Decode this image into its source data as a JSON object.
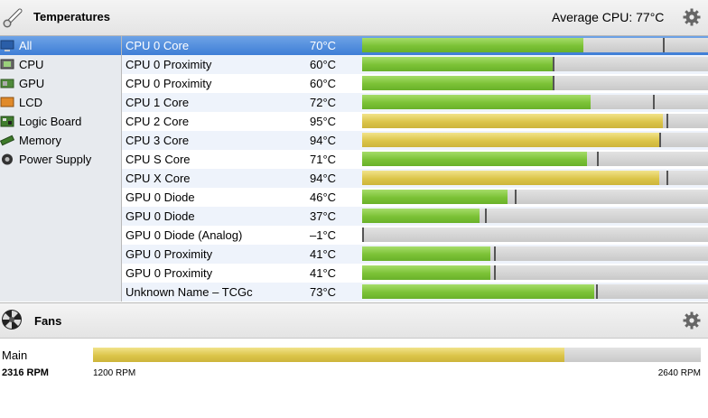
{
  "temperatures": {
    "title": "Temperatures",
    "average_label": "Average CPU:  77°C"
  },
  "sidebar": {
    "items": [
      {
        "label": "All",
        "icon": "all-icon",
        "selected": true
      },
      {
        "label": "CPU",
        "icon": "cpu-icon"
      },
      {
        "label": "GPU",
        "icon": "gpu-icon"
      },
      {
        "label": "LCD",
        "icon": "lcd-icon"
      },
      {
        "label": "Logic Board",
        "icon": "logic-board-icon"
      },
      {
        "label": "Memory",
        "icon": "memory-icon"
      },
      {
        "label": "Power Supply",
        "icon": "power-supply-icon"
      }
    ]
  },
  "sensors": [
    {
      "name": "CPU 0 Core",
      "value": "70°C",
      "level": 0.64,
      "max_marker": 0.87,
      "color": "green",
      "selected": true
    },
    {
      "name": "CPU 0 Proximity",
      "value": "60°C",
      "level": 0.55,
      "max_marker": 0.55,
      "color": "green"
    },
    {
      "name": "CPU 0 Proximity",
      "value": "60°C",
      "level": 0.55,
      "max_marker": 0.55,
      "color": "green"
    },
    {
      "name": "CPU 1 Core",
      "value": "72°C",
      "level": 0.66,
      "max_marker": 0.84,
      "color": "green"
    },
    {
      "name": "CPU 2 Core",
      "value": "95°C",
      "level": 0.87,
      "max_marker": 0.88,
      "color": "yellow"
    },
    {
      "name": "CPU 3 Core",
      "value": "94°C",
      "level": 0.86,
      "max_marker": 0.86,
      "color": "yellow"
    },
    {
      "name": "CPU S Core",
      "value": "71°C",
      "level": 0.65,
      "max_marker": 0.68,
      "color": "green"
    },
    {
      "name": "CPU X Core",
      "value": "94°C",
      "level": 0.86,
      "max_marker": 0.88,
      "color": "yellow"
    },
    {
      "name": "GPU 0 Diode",
      "value": "46°C",
      "level": 0.42,
      "max_marker": 0.44,
      "color": "green"
    },
    {
      "name": "GPU 0 Diode",
      "value": "37°C",
      "level": 0.34,
      "max_marker": 0.355,
      "color": "green"
    },
    {
      "name": "GPU 0 Diode (Analog)",
      "value": "–1°C",
      "level": 0.0,
      "max_marker": 0.0,
      "color": "green"
    },
    {
      "name": "GPU 0 Proximity",
      "value": "41°C",
      "level": 0.37,
      "max_marker": 0.38,
      "color": "green"
    },
    {
      "name": "GPU 0 Proximity",
      "value": "41°C",
      "level": 0.37,
      "max_marker": 0.38,
      "color": "green"
    },
    {
      "name": "Unknown Name – TCGc",
      "value": "73°C",
      "level": 0.67,
      "max_marker": 0.675,
      "color": "green"
    }
  ],
  "fans": {
    "title": "Fans",
    "items": [
      {
        "name": "Main",
        "rpm": "2316 RPM",
        "min": "1200 RPM",
        "max": "2640 RPM",
        "level": 0.775
      }
    ]
  },
  "colors": {
    "selection": "#3e7ed6",
    "bar_green": "#7cc236",
    "bar_yellow": "#dcc54a",
    "sidebar_bg": "#e7eaee"
  }
}
